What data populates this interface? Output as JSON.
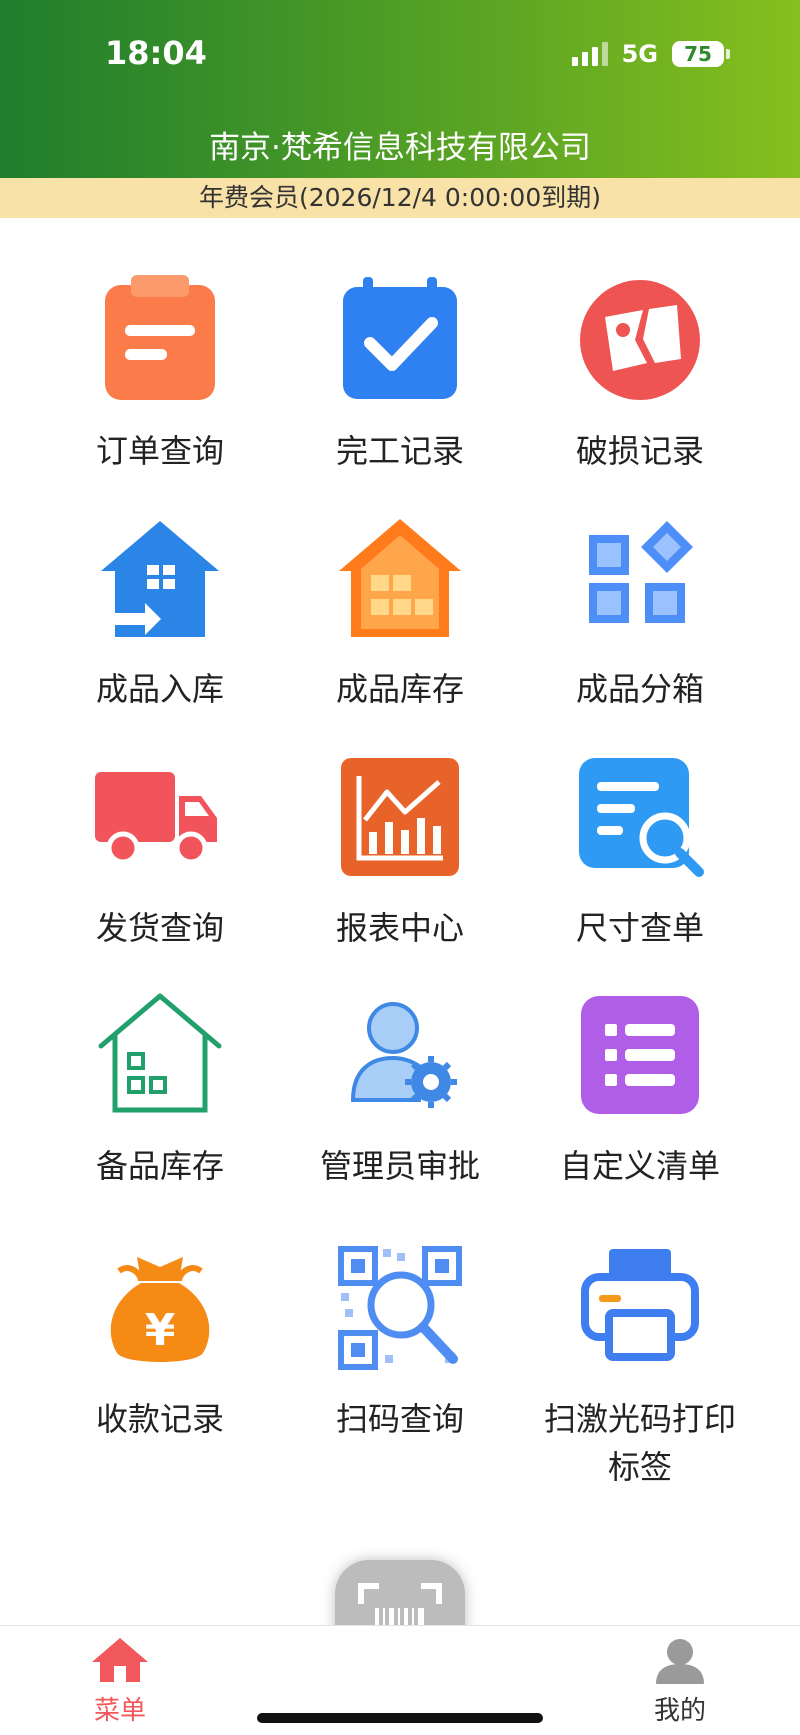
{
  "status_bar": {
    "time": "18:04",
    "network": "5G",
    "battery": "75"
  },
  "header": {
    "company": "南京·梵希信息科技有限公司"
  },
  "membership": {
    "text": "年费会员(2026/12/4 0:00:00到期)"
  },
  "menu": {
    "items": [
      {
        "label": "订单查询",
        "icon": "clipboard-icon"
      },
      {
        "label": "完工记录",
        "icon": "calendar-check-icon"
      },
      {
        "label": "破损记录",
        "icon": "broken-photo-icon"
      },
      {
        "label": "成品入库",
        "icon": "house-inbound-icon"
      },
      {
        "label": "成品库存",
        "icon": "house-inventory-icon"
      },
      {
        "label": "成品分箱",
        "icon": "boxes-grid-icon"
      },
      {
        "label": "发货查询",
        "icon": "truck-icon"
      },
      {
        "label": "报表中心",
        "icon": "chart-report-icon"
      },
      {
        "label": "尺寸查单",
        "icon": "document-search-icon"
      },
      {
        "label": "备品库存",
        "icon": "house-outline-icon"
      },
      {
        "label": "管理员审批",
        "icon": "admin-gear-icon"
      },
      {
        "label": "自定义清单",
        "icon": "list-icon"
      },
      {
        "label": "收款记录",
        "icon": "money-bag-icon"
      },
      {
        "label": "扫码查询",
        "icon": "qr-search-icon"
      },
      {
        "label": "扫激光码打印标签",
        "icon": "printer-icon"
      }
    ]
  },
  "tabbar": {
    "menu_label": "菜单",
    "mine_label": "我的",
    "active_color": "#f0585c",
    "inactive_color": "#333333"
  },
  "colors": {
    "header_start": "#1f7d2c",
    "header_end": "#86bf1e",
    "member_bar": "#f8e2a8"
  }
}
